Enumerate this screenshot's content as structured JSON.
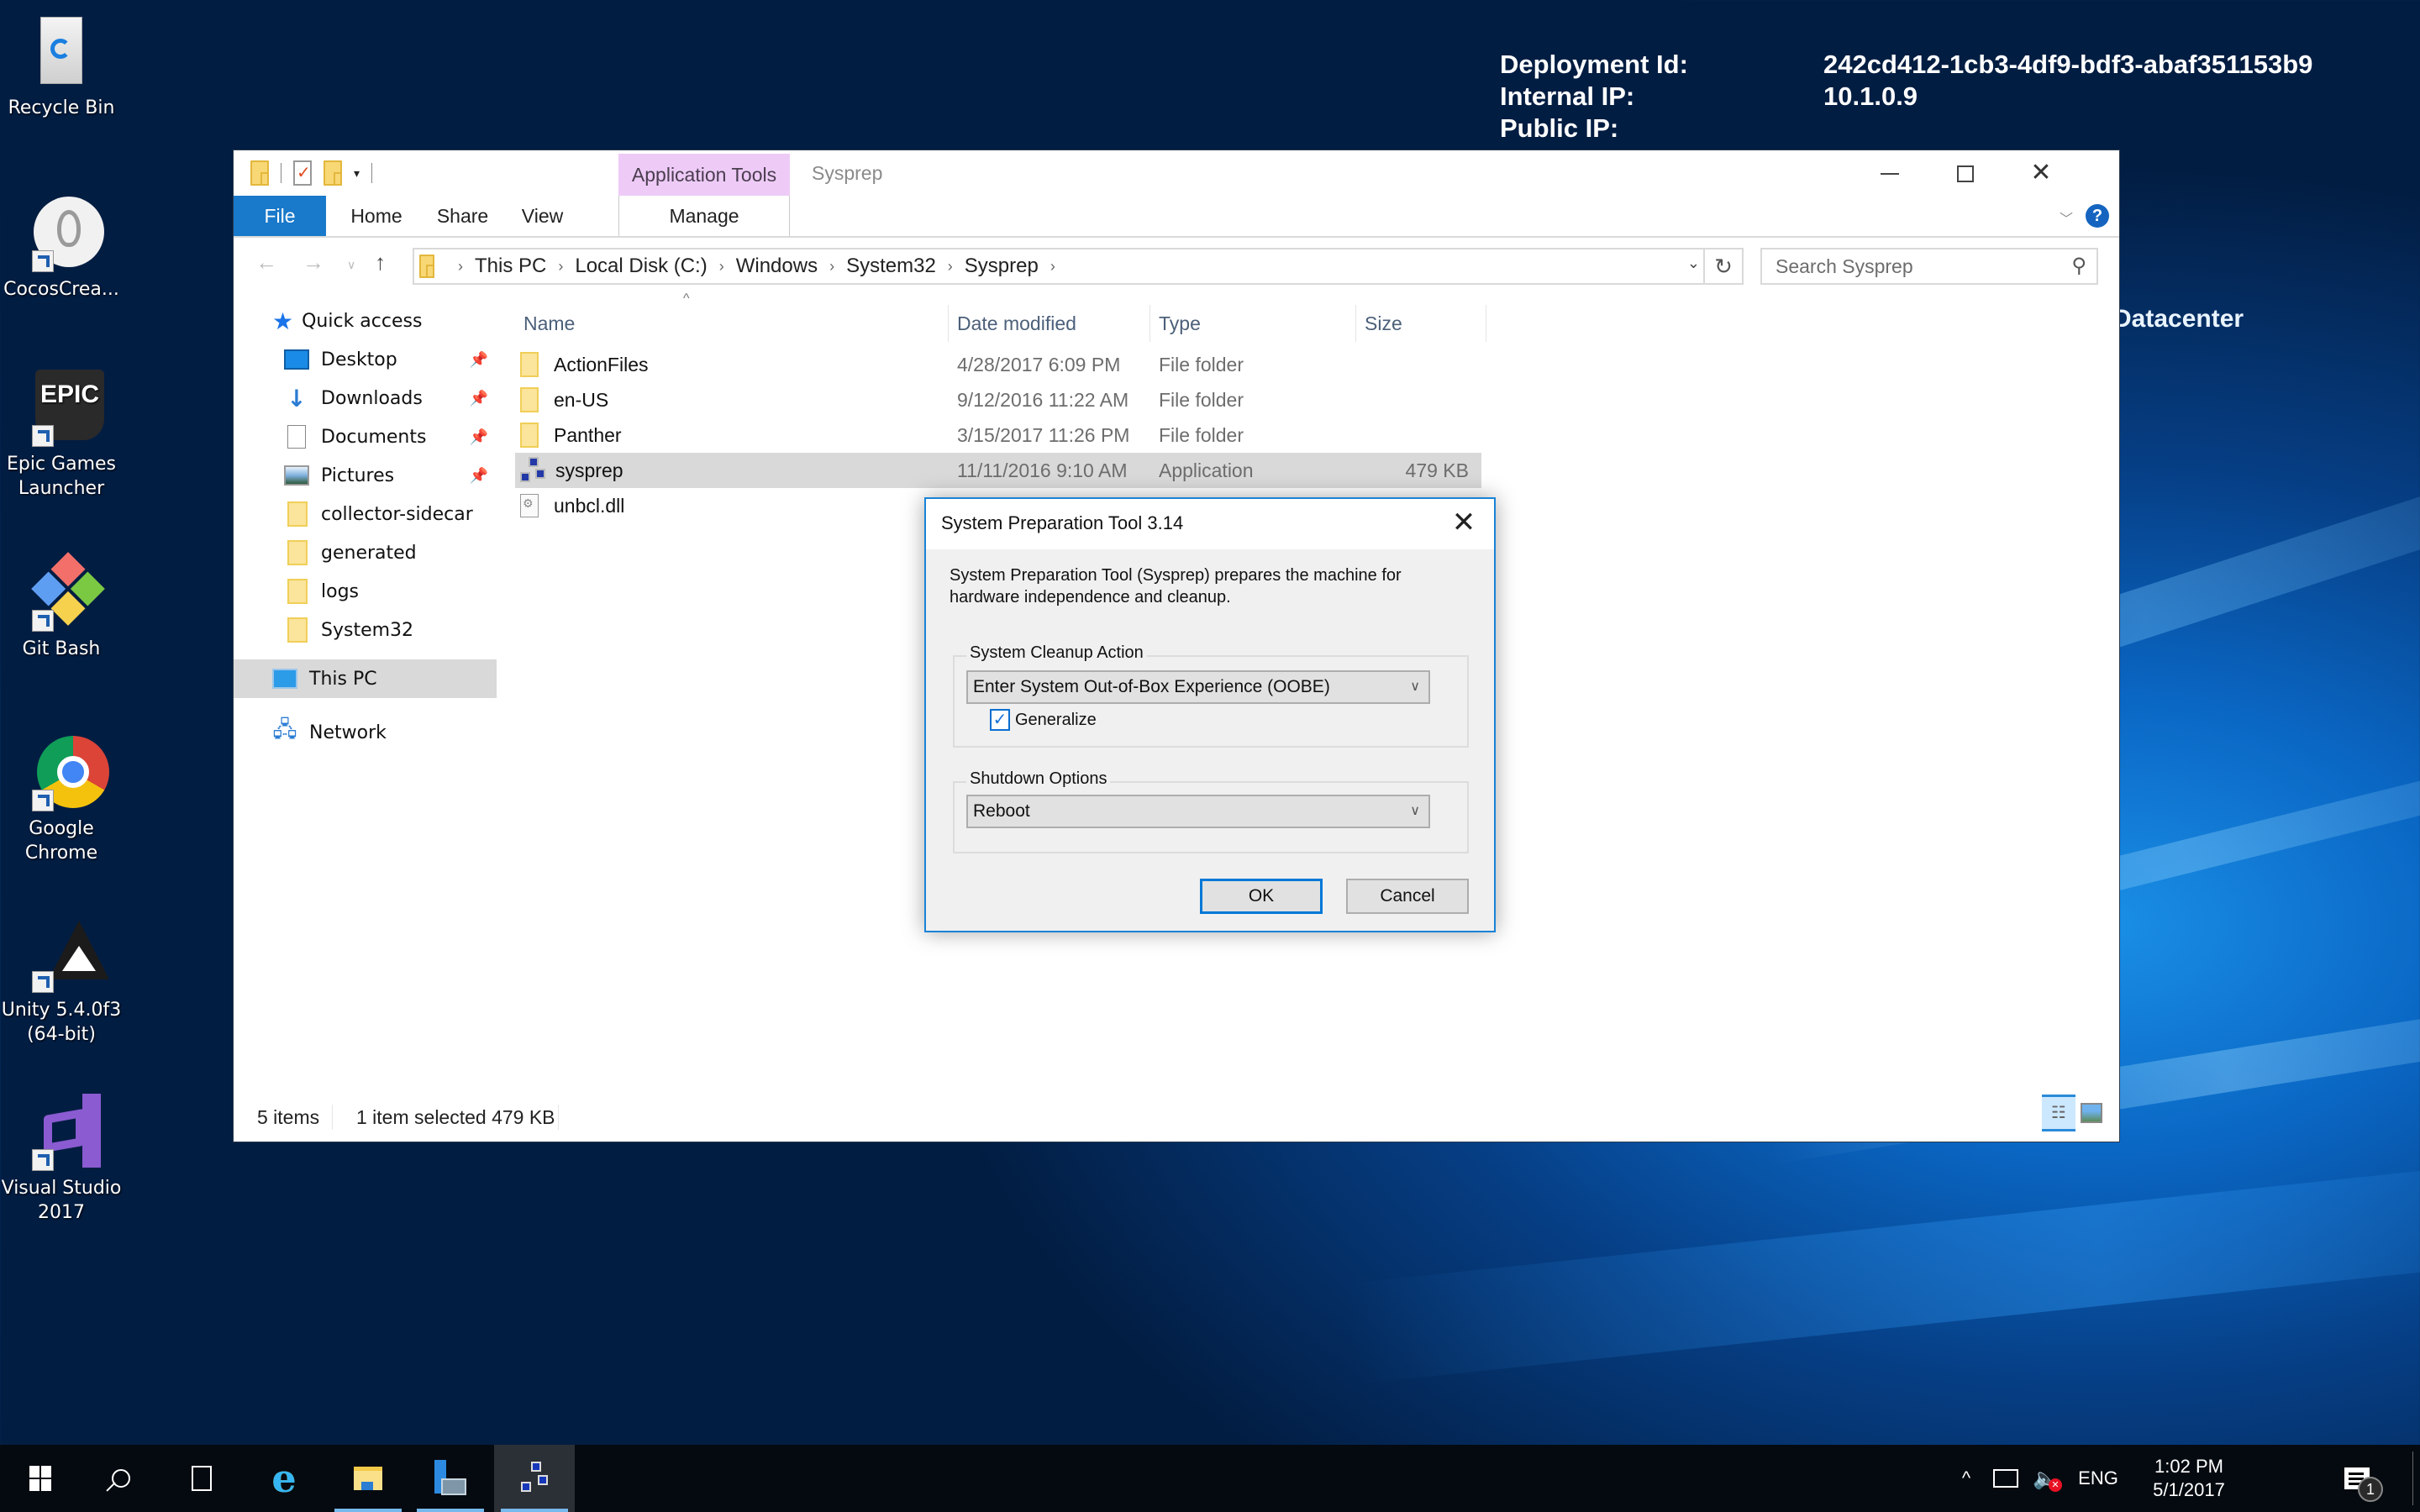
{
  "desktop": {
    "bginfo": [
      {
        "key": "Deployment Id:",
        "value": "242cd412-1cb3-4df9-bdf3-abaf351153b9"
      },
      {
        "key": "Internal IP:",
        "value": "10.1.0.9"
      },
      {
        "key": "Public IP:",
        "value": ""
      }
    ],
    "edition_text": "Datacenter",
    "icons": [
      {
        "label": "Recycle Bin",
        "icon": "recycle-bin-icon"
      },
      {
        "label": "CocosCrea...",
        "icon": "cocos-creator-icon"
      },
      {
        "label": "Epic Games Launcher",
        "icon": "epic-games-icon"
      },
      {
        "label": "Git Bash",
        "icon": "git-bash-icon"
      },
      {
        "label": "Google Chrome",
        "icon": "chrome-icon"
      },
      {
        "label": "Unity 5.4.0f3 (64-bit)",
        "icon": "unity-icon"
      },
      {
        "label": "Visual Studio 2017",
        "icon": "visual-studio-icon"
      }
    ]
  },
  "explorer": {
    "title": "Sysprep",
    "context_tab_group": "Application Tools",
    "tabs": [
      "File",
      "Home",
      "Share",
      "View",
      "Manage"
    ],
    "breadcrumb": [
      "This PC",
      "Local Disk (C:)",
      "Windows",
      "System32",
      "Sysprep"
    ],
    "search_placeholder": "Search Sysprep",
    "nav_pane": {
      "quick_access": "Quick access",
      "pinned": [
        "Desktop",
        "Downloads",
        "Documents",
        "Pictures"
      ],
      "recent": [
        "collector-sidecar",
        "generated",
        "logs",
        "System32"
      ],
      "this_pc": "This PC",
      "network": "Network"
    },
    "columns": [
      "Name",
      "Date modified",
      "Type",
      "Size"
    ],
    "files": [
      {
        "name": "ActionFiles",
        "date": "4/28/2017 6:09 PM",
        "type": "File folder",
        "size": "",
        "kind": "folder",
        "selected": false
      },
      {
        "name": "en-US",
        "date": "9/12/2016 11:22 AM",
        "type": "File folder",
        "size": "",
        "kind": "folder",
        "selected": false
      },
      {
        "name": "Panther",
        "date": "3/15/2017 11:26 PM",
        "type": "File folder",
        "size": "",
        "kind": "folder",
        "selected": false
      },
      {
        "name": "sysprep",
        "date": "11/11/2016 9:10 AM",
        "type": "Application",
        "size": "479 KB",
        "kind": "app",
        "selected": true
      },
      {
        "name": "unbcl.dll",
        "date": "",
        "type": "",
        "size": "",
        "kind": "dll",
        "selected": false
      }
    ],
    "status": {
      "item_count": "5 items",
      "selection": "1 item selected  479 KB"
    }
  },
  "dialog": {
    "title": "System Preparation Tool 3.14",
    "description": "System Preparation Tool (Sysprep) prepares the machine for hardware independence and cleanup.",
    "cleanup_group_label": "System Cleanup Action",
    "cleanup_action": "Enter System Out-of-Box Experience (OOBE)",
    "generalize_label": "Generalize",
    "generalize_checked": true,
    "shutdown_group_label": "Shutdown Options",
    "shutdown_option": "Reboot",
    "ok_label": "OK",
    "cancel_label": "Cancel"
  },
  "taskbar": {
    "apps": [
      "Start",
      "Search",
      "Task View",
      "Internet Explorer",
      "File Explorer",
      "Server Manager",
      "System Preparation Tool"
    ],
    "language": "ENG",
    "time": "1:02 PM",
    "date": "5/1/2017",
    "notification_count": "1"
  }
}
